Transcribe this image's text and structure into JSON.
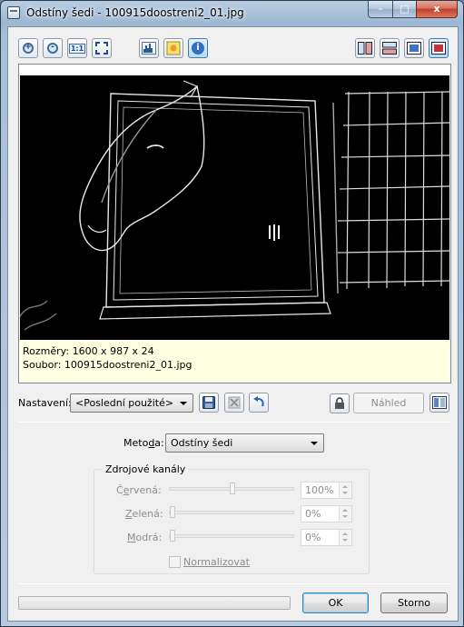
{
  "window": {
    "title": "Odstíny šedi - 100915doostreni2_01.jpg",
    "buttons": {
      "minimize": "–",
      "maximize": "□",
      "close": "x"
    }
  },
  "toolbar": {
    "left_icons": [
      "zoom-in-icon",
      "zoom-out-icon",
      "actual-size-icon",
      "fit-window-icon",
      "histogram-icon",
      "highlight-icon",
      "info-icon"
    ],
    "actual_size_label": "1:1",
    "info_label": "i",
    "right_icons": [
      "split-vertical-icon",
      "split-horizontal-icon",
      "single-view-icon",
      "original-view-icon"
    ]
  },
  "info": {
    "dimensions": "Rozměry: 1600 x 987 x 24",
    "file": "Soubor: 100915doostreni2_01.jpg"
  },
  "settings": {
    "label": "Nastavení:",
    "selected": "<Poslední použité>",
    "preview_label": "Náhled"
  },
  "method": {
    "label_pre": "Meto",
    "label_u": "d",
    "label_post": "a:",
    "selected": "Odstíny šedi"
  },
  "channels": {
    "title": "Zdrojové kanály",
    "items": [
      {
        "pre": "Č",
        "u": "e",
        "post": "rvená:",
        "value": "100%",
        "level": 1.0
      },
      {
        "pre": "",
        "u": "Z",
        "post": "elená:",
        "value": "0%",
        "level": 0.0
      },
      {
        "pre": "",
        "u": "M",
        "post": "odrá:",
        "value": "0%",
        "level": 0.0
      }
    ],
    "normalize_label": "Normalizovat"
  },
  "footer": {
    "ok": "OK",
    "cancel": "Storno"
  }
}
